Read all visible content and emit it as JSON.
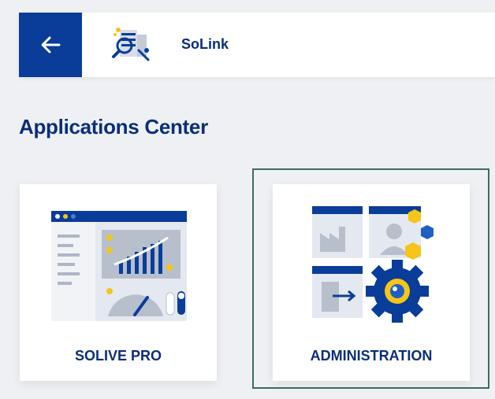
{
  "topbar": {
    "back_icon": "arrow-left-icon",
    "logo_icon": "solink-logo-icon",
    "app_name": "SoLink"
  },
  "page": {
    "title": "Applications Center"
  },
  "cards": [
    {
      "label": "SOLIVE PRO",
      "icon": "dashboard-illustration-icon",
      "selected": false
    },
    {
      "label": "ADMINISTRATION",
      "icon": "administration-illustration-icon",
      "selected": true
    }
  ],
  "colors": {
    "brand_blue": "#0a3d99",
    "title_blue": "#0a2e7a",
    "accent_yellow": "#f5c518",
    "selection_border": "#3e6b5e",
    "background": "#eef0f4"
  }
}
